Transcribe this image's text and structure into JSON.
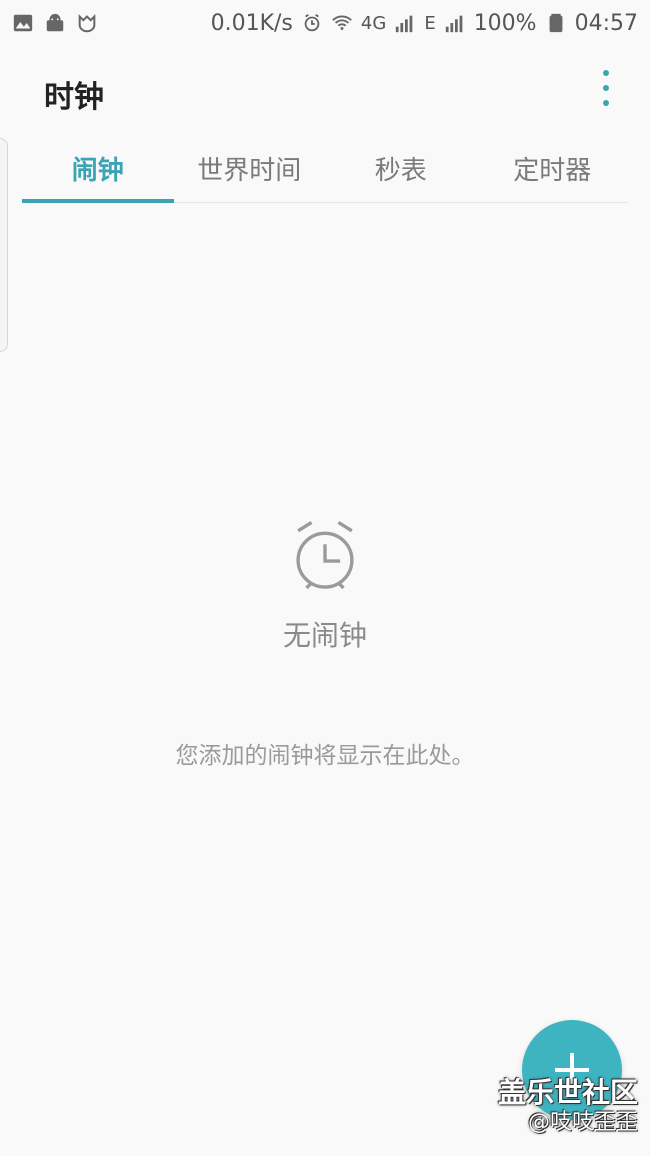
{
  "status_bar": {
    "net_speed": "0.01K/s",
    "network_type": "4G",
    "signal_label": "E",
    "battery": "100%",
    "time": "04:57",
    "icons": [
      "image-icon",
      "android-icon",
      "mi-icon",
      "alarm-icon",
      "wifi-icon",
      "signal-icon",
      "signal-e-icon",
      "battery-icon"
    ]
  },
  "header": {
    "title": "时钟"
  },
  "tabs": [
    {
      "label": "闹钟",
      "active": true
    },
    {
      "label": "世界时间",
      "active": false
    },
    {
      "label": "秒表",
      "active": false
    },
    {
      "label": "定时器",
      "active": false
    }
  ],
  "empty_state": {
    "title": "无闹钟",
    "description": "您添加的闹钟将显示在此处。"
  },
  "watermark": {
    "title": "盖乐世社区",
    "user": "@吱吱歪歪"
  },
  "colors": {
    "accent": "#3aa3b4",
    "fab": "#3fb4c1",
    "background": "#f9f9f9",
    "muted_text": "#9a9a9a"
  }
}
